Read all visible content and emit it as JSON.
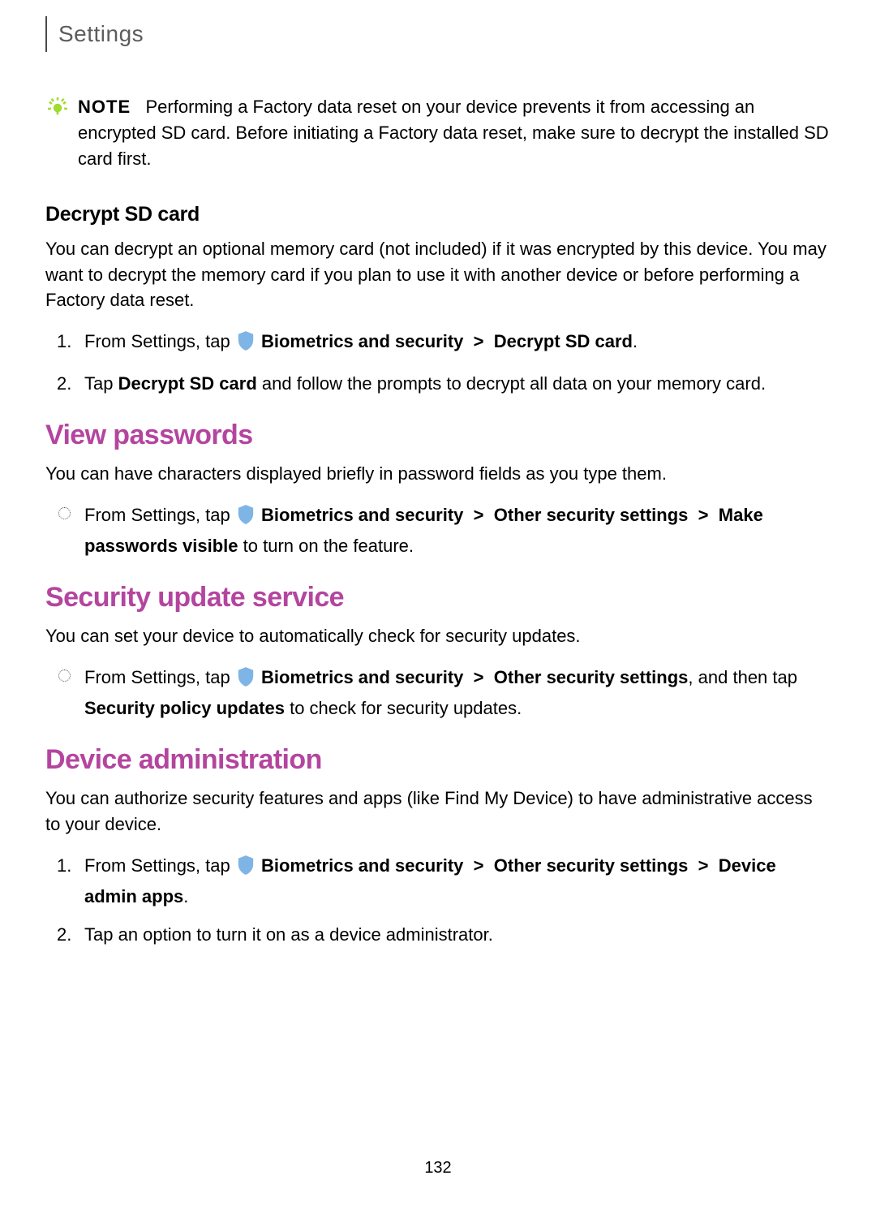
{
  "header": {
    "title": "Settings"
  },
  "note": {
    "label": "NOTE",
    "text": "Performing a Factory data reset on your device prevents it from accessing an encrypted SD card. Before initiating a Factory data reset, make sure to decrypt the installed SD card first."
  },
  "decrypt": {
    "heading": "Decrypt SD card",
    "intro": "You can decrypt an optional memory card (not included) if it was encrypted by this device. You may want to decrypt the memory card if you plan to use it with another device or before performing a Factory data reset.",
    "step1_prefix": "From Settings, tap ",
    "step1_path1": "Biometrics and security",
    "chev": ">",
    "step1_path2": "Decrypt SD card",
    "step1_suffix": ".",
    "step2_a": "Tap ",
    "step2_bold": "Decrypt SD card",
    "step2_b": " and follow the prompts to decrypt all data on your memory card."
  },
  "view_passwords": {
    "heading": "View passwords",
    "intro": "You can have characters displayed briefly in password fields as you type them.",
    "step_prefix": "From Settings, tap ",
    "path1": "Biometrics and security",
    "path2": "Other security settings",
    "path3": "Make passwords visible",
    "suffix": " to turn on the feature."
  },
  "security_update": {
    "heading": "Security update service",
    "intro": "You can set your device to automatically check for security updates.",
    "step_prefix": "From Settings, tap ",
    "path1": "Biometrics and security",
    "path2": "Other security settings",
    "mid": ", and then tap ",
    "path3": "Security policy updates",
    "suffix": " to check for security updates."
  },
  "device_admin": {
    "heading": "Device administration",
    "intro": "You can authorize security features and apps (like Find My Device) to have administrative access to your device.",
    "step1_prefix": "From Settings, tap ",
    "path1": "Biometrics and security",
    "path2": "Other security settings",
    "path3": "Device admin apps",
    "step1_suffix": ".",
    "step2": "Tap an option to turn it on as a device administrator."
  },
  "page_number": "132",
  "colors": {
    "accent": "#b4459f",
    "note_icon": "#9fdc2e",
    "shield": "#7fb4e6"
  }
}
